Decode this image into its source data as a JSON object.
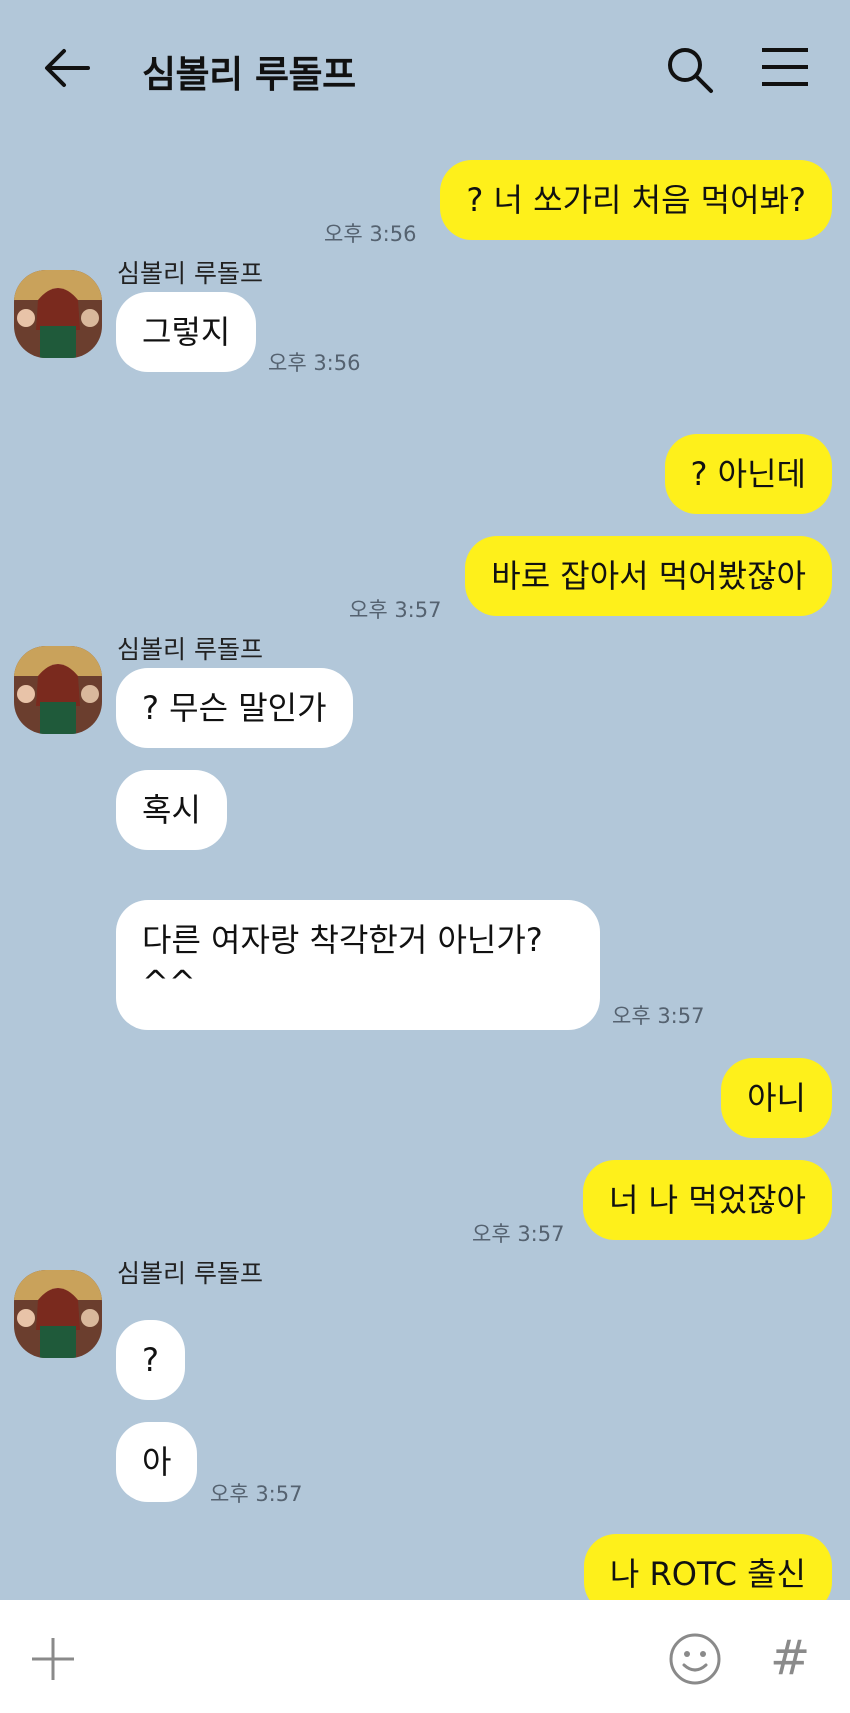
{
  "header": {
    "title": "심볼리 루돌프",
    "icons": [
      "back-arrow-icon",
      "search-icon",
      "menu-icon"
    ]
  },
  "messages": [
    {
      "from": "me",
      "text": "? 너 쏘가리 처음 먹어봐?",
      "time": "오후 3:56"
    },
    {
      "from": "other",
      "name": "심볼리 루돌프",
      "text": "그렇지",
      "time": "오후 3:56"
    },
    {
      "from": "me",
      "text": "? 아닌데",
      "time": ""
    },
    {
      "from": "me",
      "text": "바로 잡아서 먹어봤잖아",
      "time": "오후 3:57"
    },
    {
      "from": "other",
      "name": "심볼리 루돌프",
      "text": "? 무슨 말인가",
      "time": ""
    },
    {
      "from": "other",
      "text": "혹시",
      "time": ""
    },
    {
      "from": "other",
      "text_line1": "다른 여자랑 착각한거 아닌가?",
      "text_line2": "^^",
      "time": "오후 3:57"
    },
    {
      "from": "me",
      "text": "아니",
      "time": ""
    },
    {
      "from": "me",
      "text": "너 나 먹었잖아",
      "time": "오후 3:57"
    },
    {
      "from": "other",
      "name": "심볼리 루돌프",
      "text": "?",
      "time": ""
    },
    {
      "from": "other",
      "text": "아",
      "time": "오후 3:57"
    },
    {
      "from": "me",
      "text": "나 ROTC 출신",
      "time": ""
    }
  ],
  "input_bar": {
    "icons": [
      "plus-icon",
      "emoji-icon"
    ],
    "hash_label": "#"
  },
  "colors": {
    "background": "#b2c7d9",
    "my_bubble": "#fef01b",
    "other_bubble": "#ffffff"
  }
}
